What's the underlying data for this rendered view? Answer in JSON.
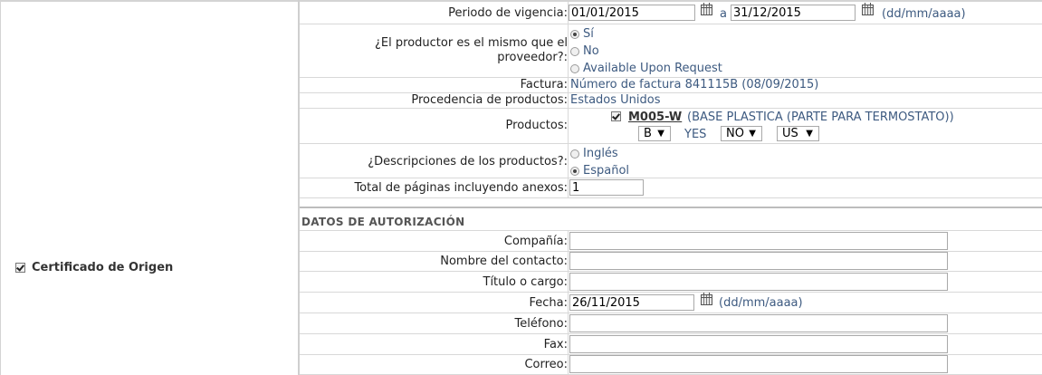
{
  "left": {
    "certificate_label": "Certificado de Origen",
    "certificate_checked": true
  },
  "vigencia": {
    "label": "Periodo de vigencia:",
    "from": "01/01/2015",
    "separator": "a",
    "to": "31/12/2015",
    "format": "(dd/mm/aaaa)"
  },
  "productor": {
    "label_line1": "¿El productor es el mismo que el",
    "label_line2": "proveedor?:",
    "options": [
      "Sí",
      "No",
      "Available Upon Request"
    ],
    "selected": "Sí"
  },
  "factura": {
    "label": "Factura:",
    "value": "Número de factura 841115B (08/09/2015)"
  },
  "procedencia": {
    "label": "Procedencia de productos:",
    "value": "Estados Unidos"
  },
  "productos": {
    "label": "Productos:",
    "code": "M005-W",
    "description": "(BASE PLASTICA (PARTE PARA TERMOSTATO))",
    "criterio": "B",
    "yes_label": "YES",
    "productor": "NO",
    "pais": "US"
  },
  "descripciones": {
    "label": "¿Descripciones de los productos?:",
    "options": [
      "Inglés",
      "Español"
    ],
    "selected": "Español"
  },
  "paginas": {
    "label": "Total de páginas incluyendo anexos:",
    "value": "1"
  },
  "autorizacion": {
    "title": "DATOS DE AUTORIZACIÓN",
    "compania_label": "Compañía:",
    "compania": "",
    "contacto_label": "Nombre del contacto:",
    "contacto": "",
    "titulo_label": "Título o cargo:",
    "titulo": "",
    "fecha_label": "Fecha:",
    "fecha": "26/11/2015",
    "fecha_format": "(dd/mm/aaaa)",
    "telefono_label": "Teléfono:",
    "telefono": "",
    "fax_label": "Fax:",
    "fax": "",
    "correo_label": "Correo:",
    "correo": ""
  }
}
